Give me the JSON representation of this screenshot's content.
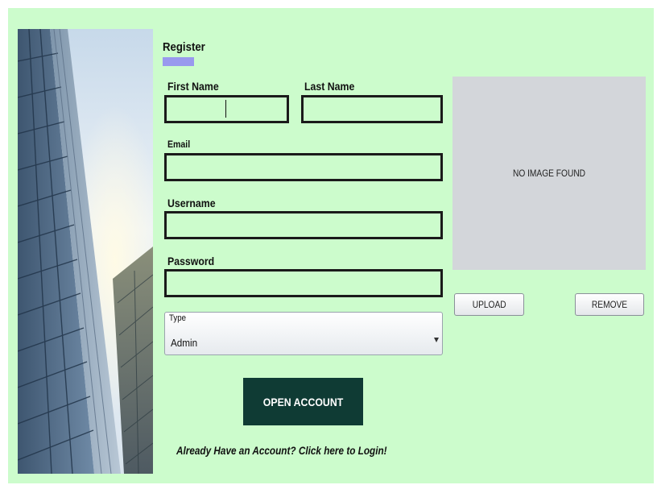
{
  "form": {
    "title": "Register",
    "first_name_label": "First Name",
    "first_name_value": "",
    "last_name_label": "Last Name",
    "last_name_value": "",
    "email_label": "Email",
    "email_value": "",
    "username_label": "Username",
    "username_value": "",
    "password_label": "Password",
    "password_value": "",
    "type_label": "Type",
    "type_selected": "Admin",
    "open_account_label": "OPEN ACCOUNT",
    "login_link": "Already Have an Account? Click here to Login!"
  },
  "image_panel": {
    "placeholder_text": "NO IMAGE FOUND",
    "upload_label": "UPLOAD",
    "remove_label": "REMOVE"
  },
  "colors": {
    "background": "#ccfccc",
    "accent_underline": "#9999ee",
    "primary_button": "#0f3b34",
    "image_placeholder": "#d3d6da"
  },
  "icons": {
    "dropdown_arrow": "chevron-down-icon",
    "side_image": "skyscraper-image"
  }
}
